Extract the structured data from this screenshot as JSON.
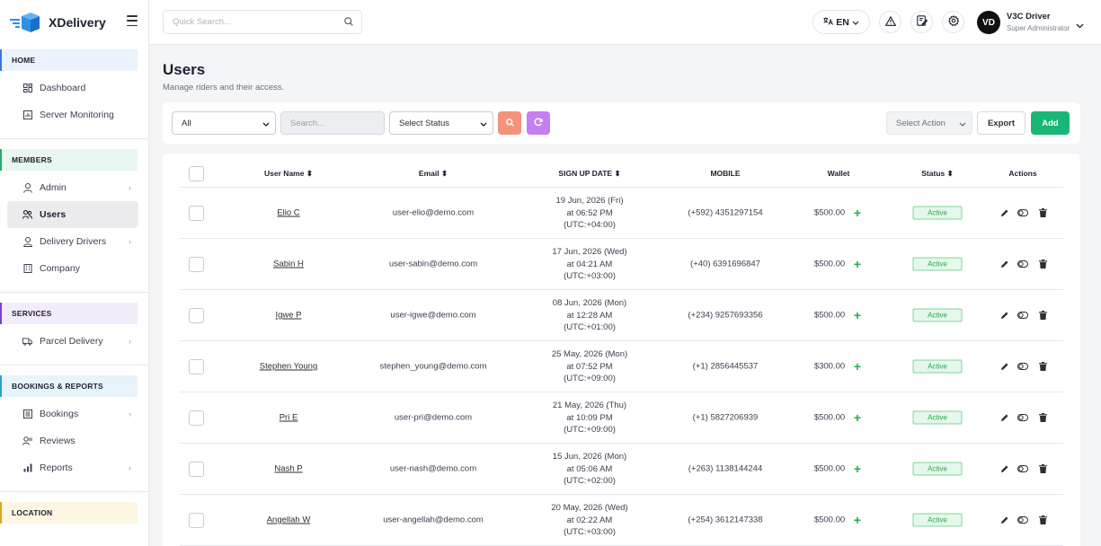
{
  "brand": {
    "name": "XDelivery"
  },
  "sidebar": {
    "sections": [
      {
        "title": "HOME",
        "items": [
          {
            "label": "Dashboard",
            "icon": "grid-icon"
          },
          {
            "label": "Server Monitoring",
            "icon": "chart-icon"
          }
        ]
      },
      {
        "title": "MEMBERS",
        "items": [
          {
            "label": "Admin",
            "icon": "user-icon",
            "chevron": true
          },
          {
            "label": "Users",
            "icon": "users-icon",
            "active": true
          },
          {
            "label": "Delivery Drivers",
            "icon": "driver-icon",
            "chevron": true
          },
          {
            "label": "Company",
            "icon": "building-icon"
          }
        ]
      },
      {
        "title": "SERVICES",
        "items": [
          {
            "label": "Parcel Delivery",
            "icon": "truck-icon",
            "chevron": true
          }
        ]
      },
      {
        "title": "BOOKINGS & REPORTS",
        "items": [
          {
            "label": "Bookings",
            "icon": "list-icon",
            "chevron": true
          },
          {
            "label": "Reviews",
            "icon": "review-icon"
          },
          {
            "label": "Reports",
            "icon": "bar-icon",
            "chevron": true
          }
        ]
      },
      {
        "title": "LOCATION",
        "items": []
      }
    ]
  },
  "topbar": {
    "search_placeholder": "Quick Search...",
    "language": "EN",
    "user": {
      "initials": "VD",
      "name": "V3C Driver",
      "role": "Super Administrator"
    }
  },
  "page": {
    "title": "Users",
    "subtitle": "Manage riders and their access."
  },
  "filters": {
    "type_value": "All",
    "search_placeholder": "Search...",
    "status_value": "Select Status",
    "action_value": "Select Action",
    "export_label": "Export",
    "add_label": "Add"
  },
  "table": {
    "headers": {
      "name": "User Name ⬍",
      "email": "Email ⬍",
      "signup": "SIGN UP DATE ⬍",
      "mobile": "MOBILE",
      "wallet": "Wallet",
      "status": "Status ⬍",
      "actions": "Actions"
    },
    "rows": [
      {
        "name": "Elio C",
        "email": "user-elio@demo.com",
        "date1": "19 Jun, 2026 (Fri)",
        "date2": "at 06:52 PM",
        "date3": "(UTC:+04:00)",
        "mobile": "(+592) 4351297154",
        "wallet": "$500.00",
        "status": "Active"
      },
      {
        "name": "Sabin H",
        "email": "user-sabin@demo.com",
        "date1": "17 Jun, 2026 (Wed)",
        "date2": "at 04:21 AM",
        "date3": "(UTC:+03:00)",
        "mobile": "(+40) 6391696847",
        "wallet": "$500.00",
        "status": "Active"
      },
      {
        "name": "Igwe P",
        "email": "user-igwe@demo.com",
        "date1": "08 Jun, 2026 (Mon)",
        "date2": "at 12:28 AM",
        "date3": "(UTC:+01:00)",
        "mobile": "(+234) 9257693356",
        "wallet": "$500.00",
        "status": "Active"
      },
      {
        "name": "Stephen Young",
        "email": "stephen_young@demo.com",
        "date1": "25 May, 2026 (Mon)",
        "date2": "at 07:52 PM",
        "date3": "(UTC:+09:00)",
        "mobile": "(+1) 2856445537",
        "wallet": "$300.00",
        "status": "Active"
      },
      {
        "name": "Pri E",
        "email": "user-pri@demo.com",
        "date1": "21 May, 2026 (Thu)",
        "date2": "at 10:09 PM",
        "date3": "(UTC:+09:00)",
        "mobile": "(+1) 5827206939",
        "wallet": "$500.00",
        "status": "Active"
      },
      {
        "name": "Nash P",
        "email": "user-nash@demo.com",
        "date1": "15 Jun, 2026 (Mon)",
        "date2": "at 05:06 AM",
        "date3": "(UTC:+02:00)",
        "mobile": "(+263) 1138144244",
        "wallet": "$500.00",
        "status": "Active"
      },
      {
        "name": "Angellah W",
        "email": "user-angellah@demo.com",
        "date1": "20 May, 2026 (Wed)",
        "date2": "at 02:22 AM",
        "date3": "(UTC:+03:00)",
        "mobile": "(+254) 3612147338",
        "wallet": "$500.00",
        "status": "Active"
      }
    ]
  },
  "colors": {
    "accent_green": "#19b675",
    "search_button": "#f4937a",
    "reset_button": "#c480f0",
    "active_badge": "#1fae47"
  }
}
